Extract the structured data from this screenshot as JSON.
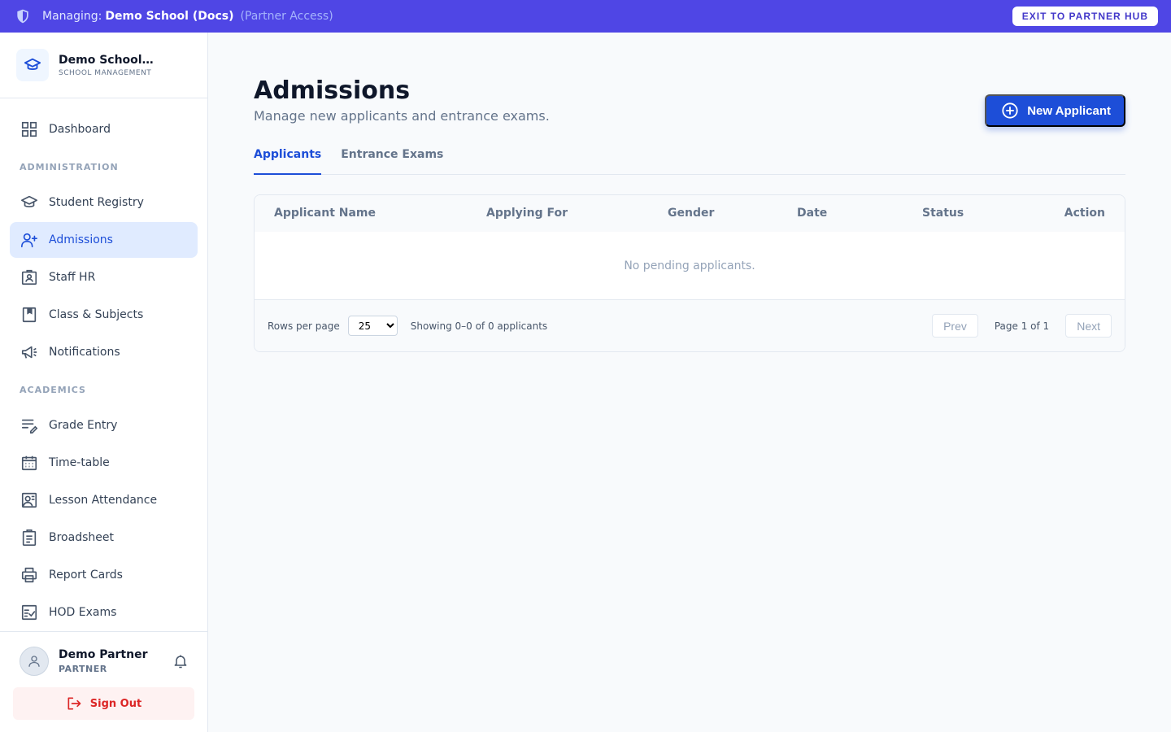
{
  "banner": {
    "managing_label": "Managing:",
    "school_name": "Demo School (Docs)",
    "access_note": "(Partner Access)",
    "exit_label": "EXIT TO PARTNER HUB"
  },
  "brand": {
    "name": "Demo School (Docs)",
    "subtitle": "SCHOOL MANAGEMENT"
  },
  "sidebar": {
    "dashboard": "Dashboard",
    "section_admin": "ADMINISTRATION",
    "admin_items": [
      "Student Registry",
      "Admissions",
      "Staff HR",
      "Class & Subjects",
      "Notifications"
    ],
    "section_academics": "ACADEMICS",
    "academic_items": [
      "Grade Entry",
      "Time-table",
      "Lesson Attendance",
      "Broadsheet",
      "Report Cards",
      "HOD Exams"
    ],
    "active_item": "Admissions"
  },
  "user": {
    "name": "Demo Partner",
    "role": "PARTNER",
    "signout_label": "Sign Out"
  },
  "page": {
    "title": "Admissions",
    "subtitle": "Manage new applicants and entrance exams.",
    "new_button": "New Applicant",
    "tabs": [
      "Applicants",
      "Entrance Exams"
    ],
    "active_tab": "Applicants"
  },
  "table": {
    "columns": [
      "Applicant Name",
      "Applying For",
      "Gender",
      "Date",
      "Status",
      "Action"
    ],
    "empty_message": "No pending applicants.",
    "rows_per_page_label": "Rows per page",
    "rows_per_page_value": "25",
    "showing": "Showing 0–0 of 0 applicants",
    "prev_label": "Prev",
    "page_info": "Page 1 of 1",
    "next_label": "Next"
  },
  "colors": {
    "banner": "#4f46e5",
    "primary": "#1d4ed8",
    "active_bg": "#e0ebff",
    "danger": "#dc2626"
  }
}
